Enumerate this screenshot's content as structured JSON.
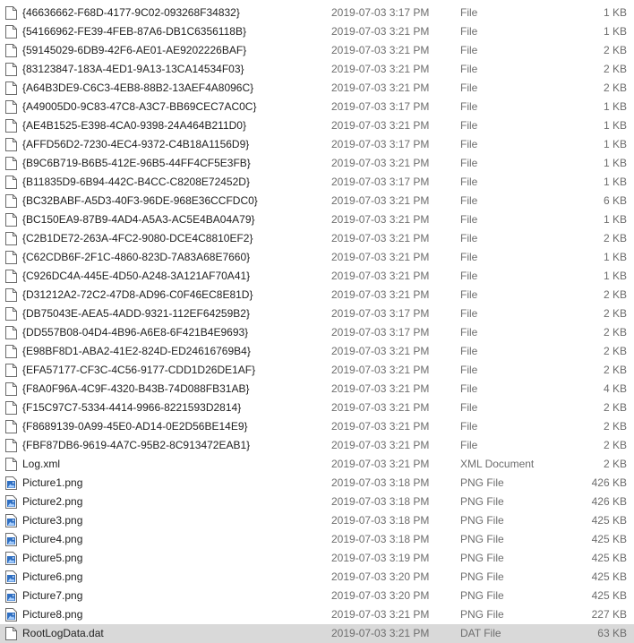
{
  "files": [
    {
      "name": "{46636662-F68D-4177-9C02-093268F34832}",
      "date": "2019-07-03 3:17 PM",
      "type": "File",
      "size": "1 KB",
      "icon": "blank-file-icon"
    },
    {
      "name": "{54166962-FE39-4FEB-87A6-DB1C6356118B}",
      "date": "2019-07-03 3:21 PM",
      "type": "File",
      "size": "1 KB",
      "icon": "blank-file-icon"
    },
    {
      "name": "{59145029-6DB9-42F6-AE01-AE9202226BAF}",
      "date": "2019-07-03 3:21 PM",
      "type": "File",
      "size": "2 KB",
      "icon": "blank-file-icon"
    },
    {
      "name": "{83123847-183A-4ED1-9A13-13CA14534F03}",
      "date": "2019-07-03 3:21 PM",
      "type": "File",
      "size": "2 KB",
      "icon": "blank-file-icon"
    },
    {
      "name": "{A64B3DE9-C6C3-4EB8-88B2-13AEF4A8096C}",
      "date": "2019-07-03 3:21 PM",
      "type": "File",
      "size": "2 KB",
      "icon": "blank-file-icon"
    },
    {
      "name": "{A49005D0-9C83-47C8-A3C7-BB69CEC7AC0C}",
      "date": "2019-07-03 3:17 PM",
      "type": "File",
      "size": "1 KB",
      "icon": "blank-file-icon"
    },
    {
      "name": "{AE4B1525-E398-4CA0-9398-24A464B211D0}",
      "date": "2019-07-03 3:21 PM",
      "type": "File",
      "size": "1 KB",
      "icon": "blank-file-icon"
    },
    {
      "name": "{AFFD56D2-7230-4EC4-9372-C4B18A1156D9}",
      "date": "2019-07-03 3:17 PM",
      "type": "File",
      "size": "1 KB",
      "icon": "blank-file-icon"
    },
    {
      "name": "{B9C6B719-B6B5-412E-96B5-44FF4CF5E3FB}",
      "date": "2019-07-03 3:21 PM",
      "type": "File",
      "size": "1 KB",
      "icon": "blank-file-icon"
    },
    {
      "name": "{B11835D9-6B94-442C-B4CC-C8208E72452D}",
      "date": "2019-07-03 3:17 PM",
      "type": "File",
      "size": "1 KB",
      "icon": "blank-file-icon"
    },
    {
      "name": "{BC32BABF-A5D3-40F3-96DE-968E36CCFDC0}",
      "date": "2019-07-03 3:21 PM",
      "type": "File",
      "size": "6 KB",
      "icon": "blank-file-icon"
    },
    {
      "name": "{BC150EA9-87B9-4AD4-A5A3-AC5E4BA04A79}",
      "date": "2019-07-03 3:21 PM",
      "type": "File",
      "size": "1 KB",
      "icon": "blank-file-icon"
    },
    {
      "name": "{C2B1DE72-263A-4FC2-9080-DCE4C8810EF2}",
      "date": "2019-07-03 3:21 PM",
      "type": "File",
      "size": "2 KB",
      "icon": "blank-file-icon"
    },
    {
      "name": "{C62CDB6F-2F1C-4860-823D-7A83A68E7660}",
      "date": "2019-07-03 3:21 PM",
      "type": "File",
      "size": "1 KB",
      "icon": "blank-file-icon"
    },
    {
      "name": "{C926DC4A-445E-4D50-A248-3A121AF70A41}",
      "date": "2019-07-03 3:21 PM",
      "type": "File",
      "size": "1 KB",
      "icon": "blank-file-icon"
    },
    {
      "name": "{D31212A2-72C2-47D8-AD96-C0F46EC8E81D}",
      "date": "2019-07-03 3:21 PM",
      "type": "File",
      "size": "2 KB",
      "icon": "blank-file-icon"
    },
    {
      "name": "{DB75043E-AEA5-4ADD-9321-112EF64259B2}",
      "date": "2019-07-03 3:17 PM",
      "type": "File",
      "size": "2 KB",
      "icon": "blank-file-icon"
    },
    {
      "name": "{DD557B08-04D4-4B96-A6E8-6F421B4E9693}",
      "date": "2019-07-03 3:17 PM",
      "type": "File",
      "size": "2 KB",
      "icon": "blank-file-icon"
    },
    {
      "name": "{E98BF8D1-ABA2-41E2-824D-ED24616769B4}",
      "date": "2019-07-03 3:21 PM",
      "type": "File",
      "size": "2 KB",
      "icon": "blank-file-icon"
    },
    {
      "name": "{EFA57177-CF3C-4C56-9177-CDD1D26DE1AF}",
      "date": "2019-07-03 3:21 PM",
      "type": "File",
      "size": "2 KB",
      "icon": "blank-file-icon"
    },
    {
      "name": "{F8A0F96A-4C9F-4320-B43B-74D088FB31AB}",
      "date": "2019-07-03 3:21 PM",
      "type": "File",
      "size": "4 KB",
      "icon": "blank-file-icon"
    },
    {
      "name": "{F15C97C7-5334-4414-9966-8221593D2814}",
      "date": "2019-07-03 3:21 PM",
      "type": "File",
      "size": "2 KB",
      "icon": "blank-file-icon"
    },
    {
      "name": "{F8689139-0A99-45E0-AD14-0E2D56BE14E9}",
      "date": "2019-07-03 3:21 PM",
      "type": "File",
      "size": "2 KB",
      "icon": "blank-file-icon"
    },
    {
      "name": "{FBF87DB6-9619-4A7C-95B2-8C913472EAB1}",
      "date": "2019-07-03 3:21 PM",
      "type": "File",
      "size": "2 KB",
      "icon": "blank-file-icon"
    },
    {
      "name": "Log.xml",
      "date": "2019-07-03 3:21 PM",
      "type": "XML Document",
      "size": "2 KB",
      "icon": "blank-file-icon"
    },
    {
      "name": "Picture1.png",
      "date": "2019-07-03 3:18 PM",
      "type": "PNG File",
      "size": "426 KB",
      "icon": "image-file-icon"
    },
    {
      "name": "Picture2.png",
      "date": "2019-07-03 3:18 PM",
      "type": "PNG File",
      "size": "426 KB",
      "icon": "image-file-icon"
    },
    {
      "name": "Picture3.png",
      "date": "2019-07-03 3:18 PM",
      "type": "PNG File",
      "size": "425 KB",
      "icon": "image-file-icon"
    },
    {
      "name": "Picture4.png",
      "date": "2019-07-03 3:18 PM",
      "type": "PNG File",
      "size": "425 KB",
      "icon": "image-file-icon"
    },
    {
      "name": "Picture5.png",
      "date": "2019-07-03 3:19 PM",
      "type": "PNG File",
      "size": "425 KB",
      "icon": "image-file-icon"
    },
    {
      "name": "Picture6.png",
      "date": "2019-07-03 3:20 PM",
      "type": "PNG File",
      "size": "425 KB",
      "icon": "image-file-icon"
    },
    {
      "name": "Picture7.png",
      "date": "2019-07-03 3:20 PM",
      "type": "PNG File",
      "size": "425 KB",
      "icon": "image-file-icon"
    },
    {
      "name": "Picture8.png",
      "date": "2019-07-03 3:21 PM",
      "type": "PNG File",
      "size": "227 KB",
      "icon": "image-file-icon"
    },
    {
      "name": "RootLogData.dat",
      "date": "2019-07-03 3:21 PM",
      "type": "DAT File",
      "size": "63 KB",
      "icon": "blank-file-icon",
      "selected": true
    }
  ],
  "colors": {
    "text_primary": "#1e1e1e",
    "text_secondary": "#6d6d6d",
    "selection_bg": "#d9d9d9",
    "image_icon_blue": "#2f6fc2"
  }
}
